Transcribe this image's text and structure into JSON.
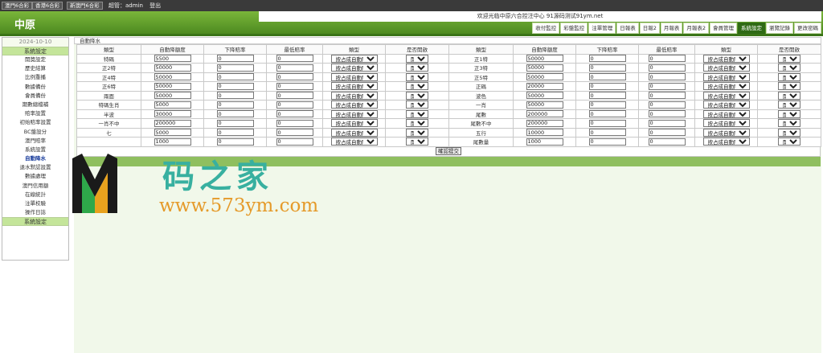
{
  "topbar": {
    "lottery_buttons": [
      "澳門6合彩",
      "香港6合彩",
      "新澳門6合彩"
    ],
    "admin_text": "超管：admin",
    "logout": "登出"
  },
  "header": {
    "logo": "中原",
    "welcome": "欢迎光临中原六合控注中心 91源码测试91ym.net",
    "tabs": [
      "收付監控",
      "彩盤監控",
      "注單管理",
      "日報表",
      "日報2",
      "月報表",
      "月報表2",
      "會員管理",
      "系統設定",
      "瀏覽記錄",
      "更改密碼"
    ],
    "active_tab": 8
  },
  "sidebar": {
    "date": "2024-10-10",
    "title": "系統設定",
    "items": [
      "開獎設定",
      "歷史結算",
      "比例重播",
      "數據備份",
      "會員備份",
      "期數總檔補",
      "賠率設置",
      "初始賠率設置",
      "BC盤設分",
      "澳門賠率",
      "系統設置",
      "自動降水",
      "退水默認設置",
      "數據處理",
      "澳門信用額",
      "在線統計",
      "注單校驗",
      "操作日誌"
    ],
    "current_index": 11,
    "footer_title": "系統設定"
  },
  "main": {
    "breadcrumb": "自動降水",
    "headers": [
      "類型",
      "自動降額度",
      "下降賠率",
      "最低賠率",
      "類型",
      "是否開啟",
      "類型",
      "自動降額度",
      "下降賠率",
      "最低賠率",
      "類型",
      "是否開啟"
    ],
    "mode_option": "按占成自動降",
    "open_option": "開啟",
    "rows": [
      {
        "l": [
          "特碼",
          "5500",
          "0",
          "0"
        ],
        "r": [
          "正1特",
          "50000",
          "0",
          "0"
        ]
      },
      {
        "l": [
          "正2特",
          "50000",
          "0",
          "0"
        ],
        "r": [
          "正3特",
          "50000",
          "0",
          "0"
        ]
      },
      {
        "l": [
          "正4特",
          "50000",
          "0",
          "0"
        ],
        "r": [
          "正5特",
          "50000",
          "0",
          "0"
        ]
      },
      {
        "l": [
          "正6特",
          "50000",
          "0",
          "0"
        ],
        "r": [
          "正碼",
          "20000",
          "0",
          "0"
        ]
      },
      {
        "l": [
          "兩面",
          "50000",
          "0",
          "0"
        ],
        "r": [
          "波色",
          "50000",
          "0",
          "0"
        ]
      },
      {
        "l": [
          "特碼生肖",
          "5000",
          "0",
          "0"
        ],
        "r": [
          "一肖",
          "50000",
          "0",
          "0"
        ]
      },
      {
        "l": [
          "半波",
          "30000",
          "0",
          "0"
        ],
        "r": [
          "尾數",
          "200000",
          "0",
          "0"
        ]
      },
      {
        "l": [
          "一肖不中",
          "200000",
          "0",
          "0"
        ],
        "r": [
          "尾數不中",
          "200000",
          "0",
          "0"
        ]
      },
      {
        "l": [
          "七",
          "5000",
          "0",
          "0"
        ],
        "r": [
          "五行",
          "10000",
          "0",
          "0"
        ]
      },
      {
        "l": [
          "",
          "1000",
          "0",
          "0"
        ],
        "r": [
          "尾數量",
          "1000",
          "0",
          "0"
        ]
      }
    ],
    "submit": "確認提交"
  },
  "watermark": {
    "text_cn": "码之家",
    "url": "www.573ym.com"
  }
}
